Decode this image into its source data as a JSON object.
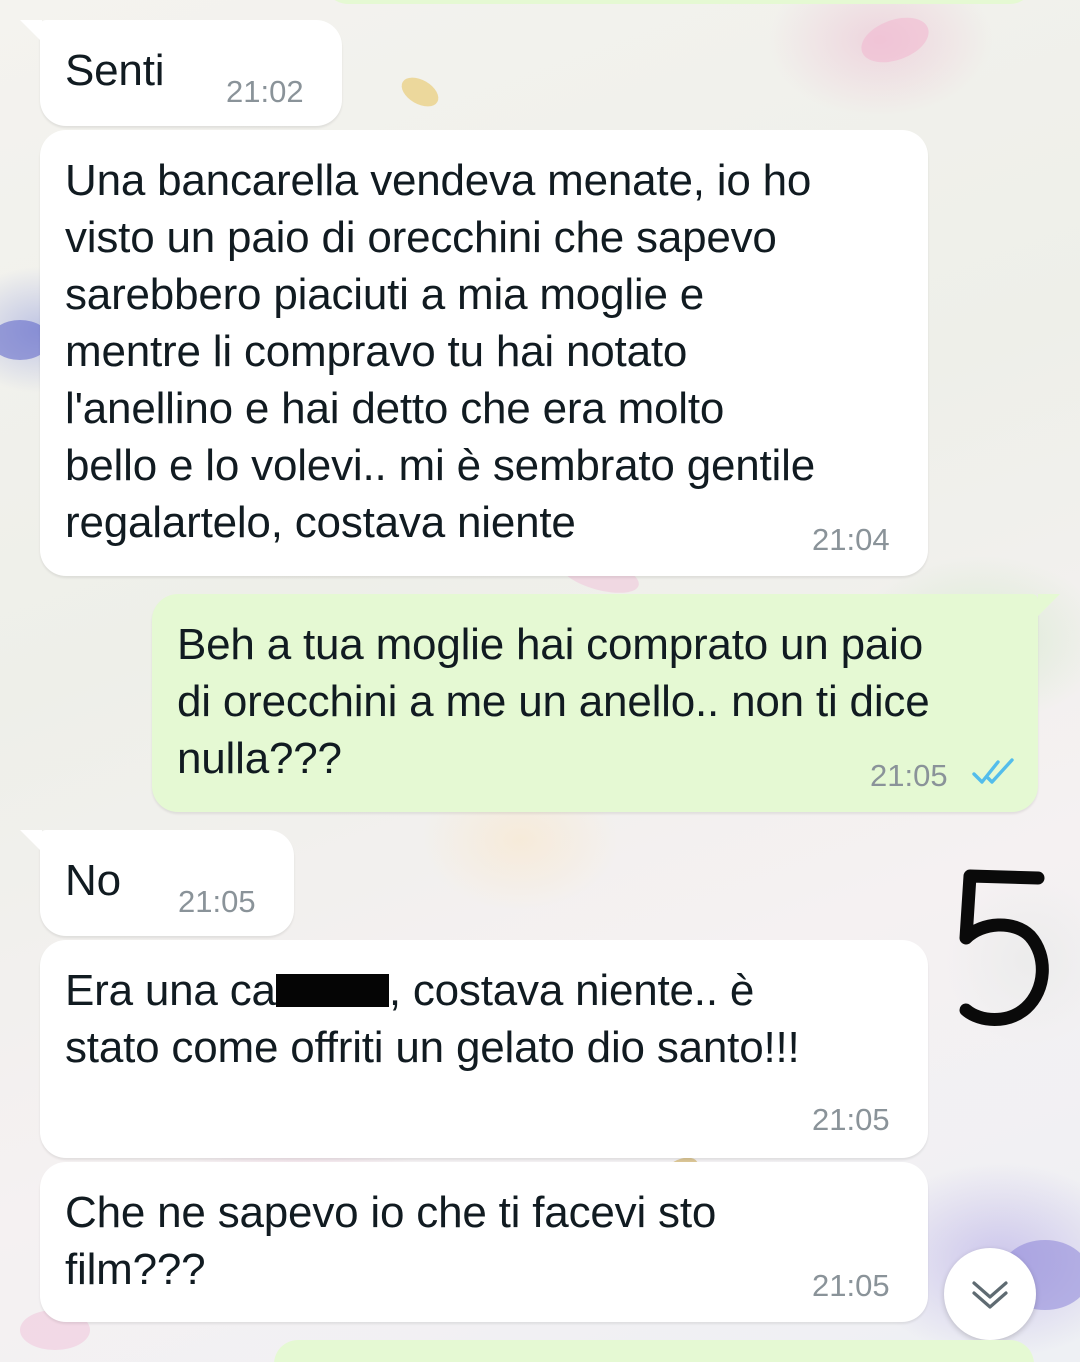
{
  "chat": {
    "messages": [
      {
        "id": "m1",
        "direction": "incoming",
        "text": "Senti",
        "time": "21:02"
      },
      {
        "id": "m2",
        "direction": "incoming",
        "text": "Una bancarella vendeva menate, io ho\nvisto un paio di orecchini che sapevo\nsarebbero piaciuti a mia moglie e\nmentre li compravo tu hai notato\nl'anellino e hai detto che era molto\nbello e lo volevi.. mi è sembrato gentile\nregalartelo, costava niente",
        "time": "21:04"
      },
      {
        "id": "m3",
        "direction": "outgoing",
        "text": "Beh a tua moglie hai comprato un paio\ndi orecchini a me un anello.. non ti dice\nnulla???",
        "time": "21:05",
        "status": "read",
        "status_color": "#53bdeb"
      },
      {
        "id": "m4",
        "direction": "incoming",
        "text": "No",
        "time": "21:05"
      },
      {
        "id": "m5",
        "direction": "incoming",
        "text_before_redaction": "Era una ca",
        "text_after_redaction": ", costava niente.. è\nstato come offriti un gelato dio santo!!!",
        "time": "21:05"
      },
      {
        "id": "m6",
        "direction": "incoming",
        "text": "Che ne sapevo io che ti facevi sto\nfilm???",
        "time": "21:05"
      }
    ]
  },
  "annotation": {
    "label": "5",
    "color": "#0a0a0a"
  },
  "controls": {
    "scroll_down_icon": "chevron-double-down-icon"
  },
  "colors": {
    "incoming_bubble": "#ffffff",
    "outgoing_bubble": "#e5f9d3",
    "timestamp": "#8a9399",
    "text": "#111b21"
  }
}
